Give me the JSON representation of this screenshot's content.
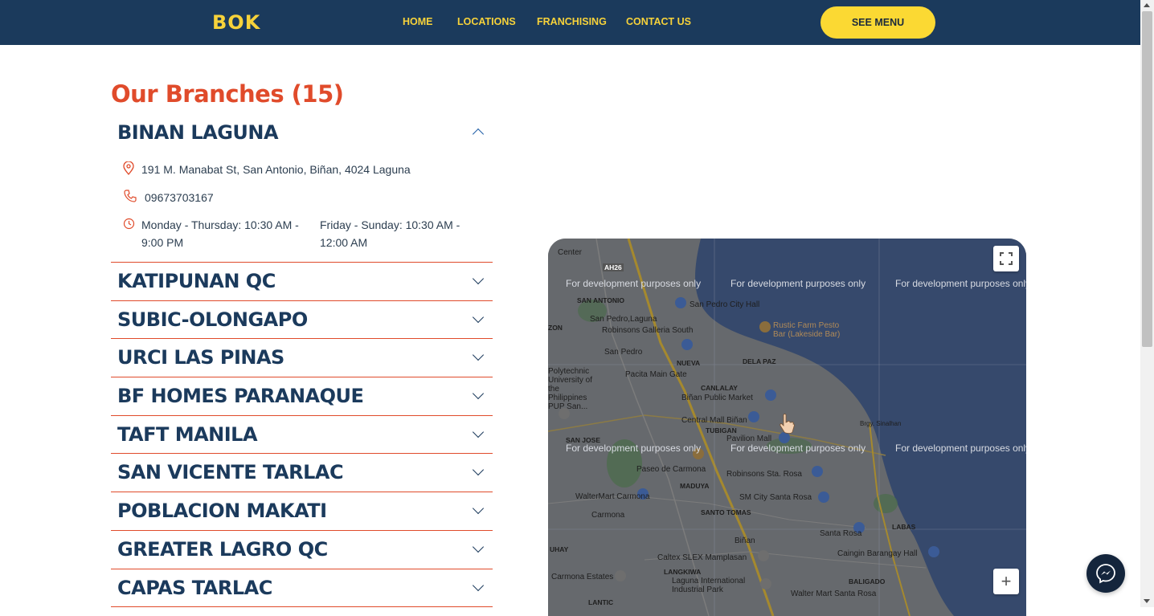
{
  "header": {
    "logo_text": "BOK",
    "nav": [
      "HOME",
      "LOCATIONS",
      "FRANCHISING",
      "CONTACT US"
    ],
    "cta_label": "SEE MENU",
    "colors": {
      "bar": "#1b3a5c",
      "accent": "#f7d23a"
    }
  },
  "branches": {
    "title": "Our Branches (15)",
    "expanded": {
      "name": "BINAN LAGUNA",
      "address": "191 M. Manabat St, San Antonio, Biñan, 4024 Laguna",
      "phone": "09673703167",
      "hours_weekday": "Monday - Thursday: 10:30 AM - 9:00 PM",
      "hours_weekend": "Friday - Sunday: 10:30 AM - 12:00 AM"
    },
    "items": [
      "KATIPUNAN QC",
      "SUBIC-OLONGAPO",
      "URCI LAS PINAS",
      "BF HOMES PARANAQUE",
      "TAFT MANILA",
      "SAN VICENTE TARLAC",
      "POBLACION MAKATI",
      "GREATER LAGRO QC",
      "CAPAS TARLAC"
    ]
  },
  "map": {
    "watermark": "For development purposes only",
    "labels": {
      "l1": "Center",
      "l2": "SAN ANTONIO",
      "l3": "San Pedro City Hall",
      "l4": "San Pedro,Laguna",
      "l5": "Robinsons Galleria South",
      "l6": "Rustic Farm Pesto Bar (Lakeside Bar)",
      "l7": "San Pedro",
      "l8": "NUEVA",
      "l9": "DELA PAZ",
      "l10": "Pacita Main Gate",
      "l11": "CANLALAY",
      "l12": "Biñan Public Market",
      "l13": "Polytechnic University of the Philippines PUP San...",
      "l14": "Central Mall Biñan",
      "l15": "TUBIGAN",
      "l16": "Pavilion Mall",
      "l17": "SAN JOSE",
      "l18": "Paseo de Carmona",
      "l19": "Robinsons Sta. Rosa",
      "l20": "MADUYA",
      "l21": "WalterMart Carmona",
      "l22": "SM City Santa Rosa",
      "l23": "SANTO TOMAS",
      "l24": "Carmona",
      "l25": "Santa Rosa",
      "l26": "LABAS",
      "l27": "Biñan",
      "l28": "Caltex SLEX Mamplasan",
      "l29": "Caingin Barangay Hall",
      "l30": "Carmona Estates",
      "l31": "LANGKIWA",
      "l32": "Laguna International Industrial Park",
      "l33": "UHAY",
      "l34": "ZON",
      "l35": "BALIGADO",
      "l36": "Walter Mart Santa Rosa",
      "l37": "LANTIC",
      "l38": "AH26",
      "l39": "Brgy. Sinalhan"
    },
    "zoom_in": "+"
  }
}
